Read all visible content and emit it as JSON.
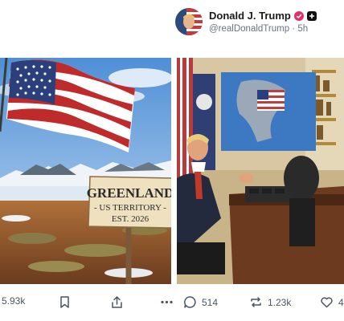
{
  "post": {
    "author_name": "Donald J. Trump",
    "handle": "@realDonaldTrump",
    "time_ago": "5h",
    "separator": "·"
  },
  "left_image": {
    "sign_line1": "GREENLAND",
    "sign_line2": "- US TERRITORY -",
    "sign_line3": "EST. 2026"
  },
  "actions": {
    "left_count": "5.93k",
    "comments": "514",
    "reposts": "1.23k",
    "likes": "4"
  },
  "colors": {
    "accent_pink": "#e1306c",
    "text_muted": "#6b7280"
  }
}
